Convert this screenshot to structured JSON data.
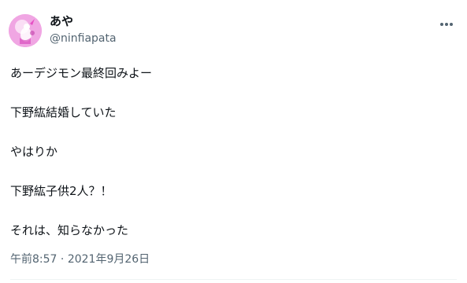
{
  "tweet": {
    "author": {
      "display_name": "あや",
      "handle": "@ninfiapata",
      "avatar_icon": "avatar-image"
    },
    "more_icon": "more-horizontal-icon",
    "paragraphs": [
      "あーデジモン最終回みよー",
      "下野紘結婚していた",
      "やはりか",
      "下野紘子供2人？！",
      "それは、知らなかった"
    ],
    "time": "午前8:57",
    "separator": "·",
    "date": "2021年9月26日"
  },
  "colors": {
    "text": "#0f1419",
    "secondary": "#536471",
    "avatar_accent": "#e85ccc",
    "divider": "#eff3f4"
  }
}
